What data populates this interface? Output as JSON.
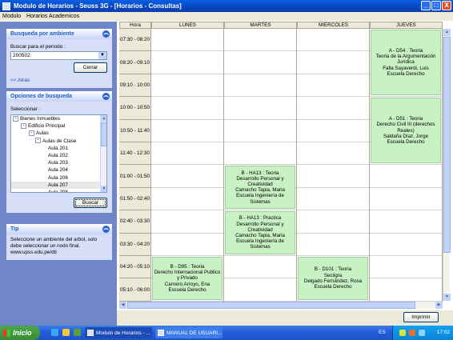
{
  "window": {
    "title": "Modulo de Horarios - Seuss 3G - [Horarios - Consultas]",
    "buttons": [
      "_",
      "□",
      "X"
    ]
  },
  "menu": [
    "Modulo",
    "Horarios Academicos"
  ],
  "search_panel": {
    "title": "Busqueda por ambiente",
    "period_label": "Buscar para el periodo :",
    "period_value": "200502",
    "close_label": "Cerrar",
    "back_link": "<< Atras"
  },
  "options_panel": {
    "title": "Opciones de busqueda",
    "select_label": "Seleccionar :",
    "tree": [
      {
        "label": "Bienes Inmuebles",
        "level": 0,
        "expander": "-"
      },
      {
        "label": "Edificio Principal",
        "level": 1,
        "expander": "-"
      },
      {
        "label": "Aulas",
        "level": 2,
        "expander": "-"
      },
      {
        "label": "Aulas de Clase",
        "level": 3,
        "expander": "-"
      },
      {
        "label": "Aula 201",
        "level": 4
      },
      {
        "label": "Aula 202",
        "level": 4
      },
      {
        "label": "Aula 203",
        "level": 4
      },
      {
        "label": "Aula 204",
        "level": 4
      },
      {
        "label": "Aula 206",
        "level": 4
      },
      {
        "label": "Aula 207",
        "level": 4,
        "selected": true
      },
      {
        "label": "Aula 208",
        "level": 4
      }
    ],
    "search_label": "Buscar"
  },
  "tip_panel": {
    "title": "Tip",
    "text": "Seleccione un ambiente del arbol, solo debe seleccionar un nodo final.",
    "link": "www.upss.edu.pe/dti"
  },
  "schedule": {
    "headers": [
      "Hora",
      "LUNES",
      "MARTES",
      "MIERCOLES",
      "JUEVES"
    ],
    "times": [
      "07:30 - 08:20",
      "08:20 - 09:10",
      "09:10 - 10:00",
      "10:00 - 10:50",
      "10:50 - 11:40",
      "11:40 - 12:30",
      "01:00 - 01:50",
      "01:50 - 02:40",
      "02:40 - 03:30",
      "03:30 - 04:20",
      "04:20 - 05:10",
      "05:10 - 06:00"
    ],
    "events": [
      {
        "day": 3,
        "start": 0,
        "slots": 3,
        "lines": [
          "A - D54 : Teoria",
          "Teoria de la Argumentación Jurídica",
          "Falla Sayaverdi, Luis",
          "Escuela Derecho"
        ]
      },
      {
        "day": 3,
        "start": 3,
        "slots": 3,
        "lines": [
          "A - D51 : Teoria",
          "Derecho Civil III (derechos Reales)",
          "Saldaña Díaz, Jorge",
          "Escuela Derecho"
        ]
      },
      {
        "day": 1,
        "start": 6,
        "slots": 2,
        "lines": [
          "B - HA13 : Teoria",
          "Desarrollo Personal y Creatividad",
          "Camacho Tapia, Maria",
          "Escuela Ingeniería de Sistemas"
        ]
      },
      {
        "day": 1,
        "start": 8,
        "slots": 2,
        "lines": [
          "B - HA13 : Practica",
          "Desarrollo Personal y Creatividad",
          "Camacho Tapia, Maria",
          "Escuela Ingeniería de Sistemas"
        ]
      },
      {
        "day": 0,
        "start": 10,
        "slots": 2,
        "lines": [
          "B - D95 : Teoria",
          "Derecho Internacional Publico y Privado",
          "Carnero Arroyo, Ena",
          "Escuela Derecho"
        ]
      },
      {
        "day": 2,
        "start": 10,
        "slots": 2,
        "lines": [
          "B - D101 : Teoria",
          "Seciigra",
          "Delgado Fernández, Rosa",
          "Escuela Derecho"
        ]
      }
    ]
  },
  "print_label": "Imprimir",
  "taskbar": {
    "start_label": "Inicio",
    "tasks": [
      "Modulo de Horarios - ...",
      "MANUAL DE USUARI..."
    ],
    "lang": "ES",
    "clock": "17:02"
  }
}
